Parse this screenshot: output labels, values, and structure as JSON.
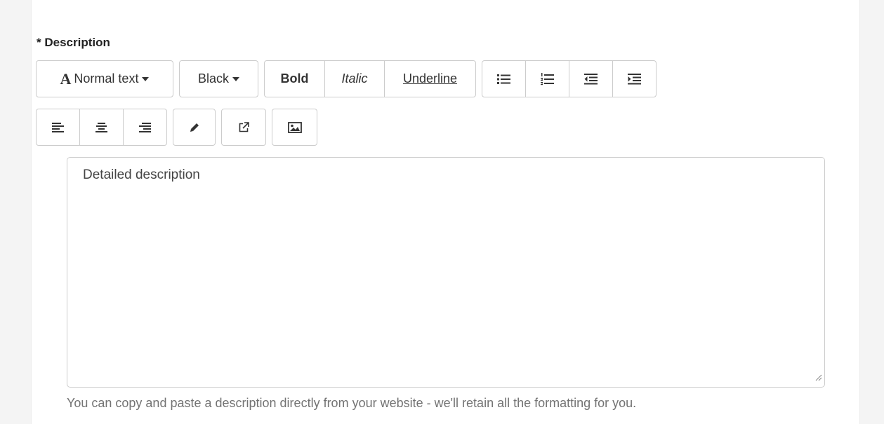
{
  "field": {
    "label": "* Description",
    "placeholder_text": "Detailed description",
    "help_text": "You can copy and paste a description directly from your website - we'll retain all the formatting for you."
  },
  "toolbar": {
    "font_size_glyph": "A",
    "font_size_label": "Normal text",
    "color_label": "Black",
    "bold_label": "Bold",
    "italic_label": "Italic",
    "underline_label": "Underline",
    "icons": {
      "unordered_list": "list-ul-icon",
      "ordered_list": "list-ol-icon",
      "outdent": "outdent-icon",
      "indent": "indent-icon",
      "align_left": "align-left-icon",
      "align_center": "align-center-icon",
      "align_right": "align-right-icon",
      "pencil": "pencil-icon",
      "link": "external-link-icon",
      "image": "image-icon"
    }
  },
  "colors": {
    "border": "#cccccc",
    "text": "#333333",
    "help_text": "#737373",
    "page_background": "#f4f4f4"
  }
}
